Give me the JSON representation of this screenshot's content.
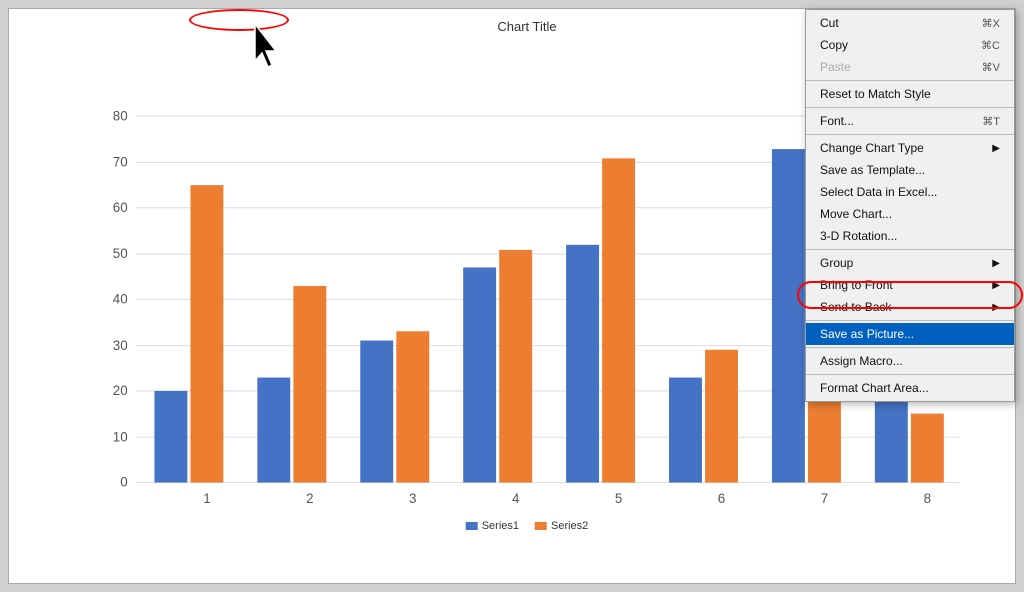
{
  "chart": {
    "title": "Chart Title",
    "series1_color": "#4472C4",
    "series2_color": "#ED7D31",
    "categories": [
      1,
      2,
      3,
      4,
      5,
      6,
      7,
      8
    ],
    "series1": [
      20,
      23,
      31,
      47,
      52,
      23,
      73,
      73
    ],
    "series2": [
      65,
      43,
      33,
      51,
      71,
      29,
      27,
      15
    ],
    "y_max": 90,
    "y_ticks": [
      0,
      10,
      20,
      30,
      40,
      50,
      60,
      70,
      80
    ],
    "legend": {
      "series1": "Series1",
      "series2": "Series2"
    }
  },
  "context_menu": {
    "items": [
      {
        "id": "cut",
        "label": "Cut",
        "shortcut": "⌘X",
        "type": "item"
      },
      {
        "id": "copy",
        "label": "Copy",
        "shortcut": "⌘C",
        "type": "item"
      },
      {
        "id": "paste",
        "label": "Paste",
        "shortcut": "⌘V",
        "type": "item",
        "disabled": true
      },
      {
        "id": "sep1",
        "type": "separator"
      },
      {
        "id": "reset",
        "label": "Reset to Match Style",
        "shortcut": "",
        "type": "item"
      },
      {
        "id": "sep2",
        "type": "separator"
      },
      {
        "id": "font",
        "label": "Font...",
        "shortcut": "⌘T",
        "type": "item"
      },
      {
        "id": "sep3",
        "type": "separator"
      },
      {
        "id": "change-chart",
        "label": "Change Chart Type",
        "shortcut": "",
        "type": "item",
        "arrow": true
      },
      {
        "id": "save-template",
        "label": "Save as Template...",
        "shortcut": "",
        "type": "item"
      },
      {
        "id": "select-data",
        "label": "Select Data in Excel...",
        "shortcut": "",
        "type": "item"
      },
      {
        "id": "move-chart",
        "label": "Move Chart...",
        "shortcut": "",
        "type": "item"
      },
      {
        "id": "3d-rotation",
        "label": "3-D Rotation...",
        "shortcut": "",
        "type": "item"
      },
      {
        "id": "sep4",
        "type": "separator"
      },
      {
        "id": "group",
        "label": "Group",
        "shortcut": "",
        "type": "item",
        "arrow": true
      },
      {
        "id": "bring-front",
        "label": "Bring to Front",
        "shortcut": "",
        "type": "item",
        "arrow": true
      },
      {
        "id": "send-back",
        "label": "Send to Back",
        "shortcut": "",
        "type": "item",
        "arrow": true
      },
      {
        "id": "sep5",
        "type": "separator"
      },
      {
        "id": "save-picture",
        "label": "Save as Picture...",
        "shortcut": "",
        "type": "item",
        "highlighted": true
      },
      {
        "id": "sep6",
        "type": "separator"
      },
      {
        "id": "assign-macro",
        "label": "Assign Macro...",
        "shortcut": "",
        "type": "item"
      },
      {
        "id": "sep7",
        "type": "separator"
      },
      {
        "id": "format-chart",
        "label": "Format Chart Area...",
        "shortcut": "",
        "type": "item"
      }
    ]
  }
}
